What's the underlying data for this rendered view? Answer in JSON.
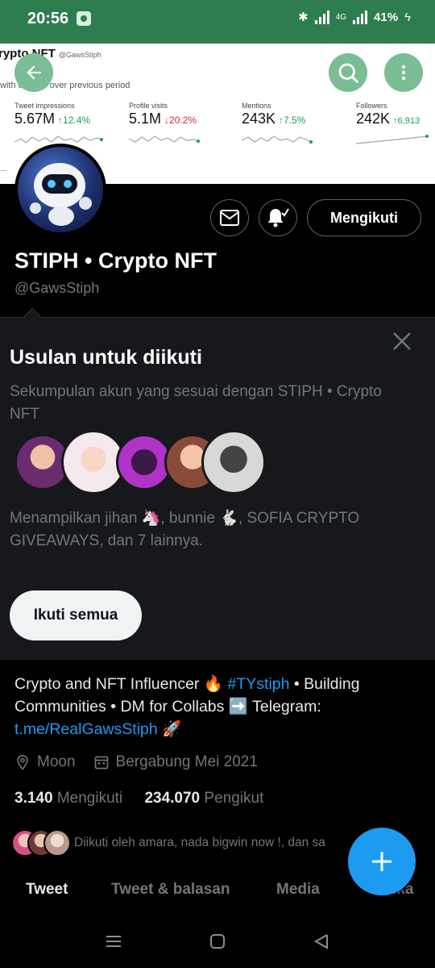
{
  "status_bar": {
    "time": "20:56",
    "network": "4G",
    "battery": "41%"
  },
  "banner": {
    "title": "rypto NFT",
    "handle": "@GawsStiph",
    "subtitle": "with change over previous period",
    "metrics": [
      {
        "label": "Tweet impressions",
        "value": "5.67M",
        "change": "↑12.4%",
        "direction": "up"
      },
      {
        "label": "Profile visits",
        "value": "5.1M",
        "change": "↓20.2%",
        "direction": "down"
      },
      {
        "label": "Mentions",
        "value": "243K",
        "change": "↑7.5%",
        "direction": "up"
      },
      {
        "label": "Followers",
        "value": "242K",
        "change": "↑6,913",
        "direction": "up"
      }
    ],
    "ellipsis": "..."
  },
  "header": {
    "back_icon": "arrow-left-icon",
    "search_icon": "search-icon",
    "more_icon": "more-vertical-icon"
  },
  "profile": {
    "name": "STIPH • Crypto NFT",
    "handle": "@GawsStiph",
    "follow_button": "Mengikuti",
    "message_icon": "envelope-icon",
    "notify_icon": "bell-check-icon"
  },
  "suggestions": {
    "title": "Usulan untuk diikuti",
    "description": "Sekumpulan akun yang sesuai dengan STIPH • Crypto NFT",
    "summary": "Menampilkan jihan 🦄, bunnie 🐇, SOFIA CRYPTO GIVEAWAYS, dan 7 lainnya.",
    "follow_all": "Ikuti semua",
    "close_icon": "close-icon"
  },
  "bio": {
    "part1": "Crypto and NFT Influencer 🔥 ",
    "hashtag": "#TYstiph",
    "part2": " • Building Communities • DM for Collabs ➡️ Telegram: ",
    "link": "t.me/RealGawsStiph",
    "part3": " 🚀"
  },
  "meta": {
    "location": "Moon",
    "joined": "Bergabung Mei 2021"
  },
  "counts": {
    "following_num": "3.140",
    "following_label": "Mengikuti",
    "followers_num": "234.070",
    "followers_label": "Pengikut"
  },
  "followed_by": "Diikuti oleh amara, nada bigwin now !, dan sa",
  "tabs": [
    "Tweet",
    "Tweet & balasan",
    "Media",
    "Suka"
  ],
  "colors": {
    "accent": "#1d9bf0",
    "status_bar": "#2e7d4f",
    "up": "#1a9e54",
    "down": "#d3243b"
  }
}
